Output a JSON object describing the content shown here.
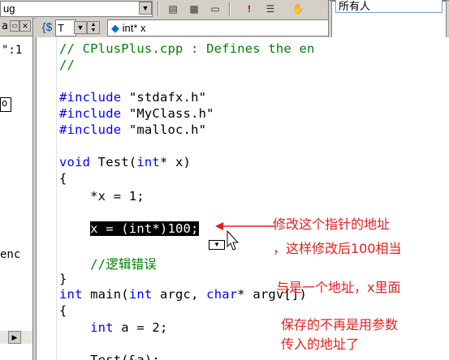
{
  "toolbar": {
    "config_combo": "ug",
    "icons": [
      "save-all-icon",
      "workspace-icon",
      "output-icon",
      "exclamation-icon",
      "list-icon",
      "hand-icon"
    ]
  },
  "left_panel": {
    "tab_label": "a",
    "rows": [
      "\":1",
      "o",
      "enc"
    ]
  },
  "editor_tabs": {
    "class_combo": "T",
    "member_combo": "int* x"
  },
  "popup": {
    "title": "所有人"
  },
  "code": {
    "comment_line1": "// CPlusPlus.cpp : Defines the en",
    "comment_line2": "//",
    "include_kw": "#include",
    "includes": [
      "\"stdafx.h\"",
      "\"MyClass.h\"",
      "\"malloc.h\""
    ],
    "void_kw": "void",
    "test_sig": " Test(",
    "int_kw": "int",
    "test_param": "* x)",
    "brace_open": "{",
    "assign_line": "    *x = 1;",
    "selected_line": "x = (int*)100;",
    "logic_comment": "    //逻辑错误",
    "brace_close": "}",
    "main_int": "int",
    "main_sig_a": " main(",
    "main_int2": "int",
    "main_sig_b": " argc, ",
    "main_char": "char",
    "main_sig_c": "* argv[])",
    "brace_open2": "{",
    "int_a_kw": "int",
    "int_a_rest": " a = 2;",
    "test_call": "    Test(&a);"
  },
  "annotations": {
    "line1": "修改这个指针的地址",
    "line2": "，这样修改后100相当",
    "line3": "与是一个地址，x里面",
    "line4": "保存的不再是用参数",
    "line5": "传入的地址了",
    "color": "#e02020"
  }
}
